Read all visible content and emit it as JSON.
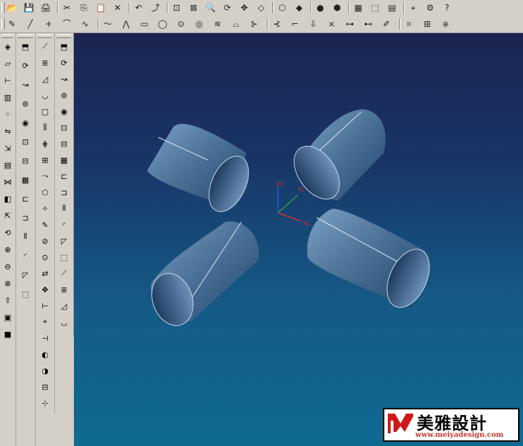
{
  "toolbar_top": {
    "buttons": [
      {
        "name": "open-icon",
        "glyph": "📂"
      },
      {
        "name": "save-icon",
        "glyph": "💾"
      },
      {
        "name": "print-icon",
        "glyph": "🖨"
      },
      {
        "name": "cut-icon",
        "glyph": "✂"
      },
      {
        "name": "copy-icon",
        "glyph": "⎘"
      },
      {
        "name": "paste-icon",
        "glyph": "📋"
      },
      {
        "name": "delete-icon",
        "glyph": "✕"
      },
      {
        "name": "undo-icon",
        "glyph": "↶"
      },
      {
        "name": "redo-icon",
        "glyph": "⤴"
      },
      {
        "name": "fit-view-icon",
        "glyph": "⊡"
      },
      {
        "name": "zoom-window-icon",
        "glyph": "⊠"
      },
      {
        "name": "zoom-icon",
        "glyph": "🔍"
      },
      {
        "name": "rotate-icon",
        "glyph": "⟳"
      },
      {
        "name": "pan-icon",
        "glyph": "✥"
      },
      {
        "name": "orient-view-icon",
        "glyph": "◇"
      },
      {
        "name": "wireframe-icon",
        "glyph": "⬡"
      },
      {
        "name": "shaded-icon",
        "glyph": "◆"
      },
      {
        "name": "material-icon",
        "glyph": "●"
      },
      {
        "name": "layer-icon",
        "glyph": "⬢"
      },
      {
        "name": "model-tree-icon",
        "glyph": "▦"
      },
      {
        "name": "assembly-icon",
        "glyph": "⬚"
      },
      {
        "name": "drafting-icon",
        "glyph": "▤"
      },
      {
        "name": "analysis-icon",
        "glyph": "⌖"
      },
      {
        "name": "cam-icon",
        "glyph": "⚙"
      },
      {
        "name": "help-icon",
        "glyph": "?"
      }
    ]
  },
  "toolbar_second": {
    "buttons": [
      {
        "name": "sketch-icon",
        "glyph": "✎"
      },
      {
        "name": "line-icon",
        "glyph": "╱"
      },
      {
        "name": "point-icon",
        "glyph": "+"
      },
      {
        "name": "arc-icon",
        "glyph": "⌒"
      },
      {
        "name": "curve-icon",
        "glyph": "∿"
      },
      {
        "name": "spline-icon",
        "glyph": "〜"
      },
      {
        "name": "polyline-icon",
        "glyph": "⋀"
      },
      {
        "name": "rectangle-icon",
        "glyph": "▭"
      },
      {
        "name": "circle-icon",
        "glyph": "◯"
      },
      {
        "name": "ellipse-icon",
        "glyph": "⊙"
      },
      {
        "name": "helix-icon",
        "glyph": "◎"
      },
      {
        "name": "offset-curve-icon",
        "glyph": "≋"
      },
      {
        "name": "bridge-curve-icon",
        "glyph": "⌓"
      },
      {
        "name": "trim-icon",
        "glyph": "⊱"
      },
      {
        "name": "extend-icon",
        "glyph": "⊰"
      },
      {
        "name": "fillet-curve-icon",
        "glyph": "⌐"
      },
      {
        "name": "project-curve-icon",
        "glyph": "⇩"
      },
      {
        "name": "intersect-curve-icon",
        "glyph": "⨯"
      },
      {
        "name": "join-curve-icon",
        "glyph": "⊶"
      },
      {
        "name": "split-curve-icon",
        "glyph": "⊷"
      },
      {
        "name": "edit-curve-icon",
        "glyph": "✐"
      },
      {
        "name": "surface-icon",
        "glyph": "⌗"
      },
      {
        "name": "mesh-icon",
        "glyph": "⊞"
      },
      {
        "name": "blend-icon",
        "glyph": "⎈"
      }
    ]
  },
  "left_toolbar_a": {
    "buttons": [
      {
        "name": "feature-icon",
        "glyph": "◈"
      },
      {
        "name": "datum-plane-icon",
        "glyph": "▱"
      },
      {
        "name": "datum-axis-icon",
        "glyph": "⊢"
      },
      {
        "name": "sheet-icon",
        "glyph": "▥"
      },
      {
        "name": "pattern-icon",
        "glyph": "⁘"
      },
      {
        "name": "mirror-icon",
        "glyph": "⇋"
      },
      {
        "name": "offset-icon",
        "glyph": "⇲"
      },
      {
        "name": "thicken-icon",
        "glyph": "▤"
      },
      {
        "name": "sew-icon",
        "glyph": "⋈"
      },
      {
        "name": "trim-body-icon",
        "glyph": "◧"
      },
      {
        "name": "scale-icon",
        "glyph": "⇱"
      },
      {
        "name": "wrap-icon",
        "glyph": "⟲"
      },
      {
        "name": "unite-icon",
        "glyph": "⊕"
      },
      {
        "name": "subtract-icon",
        "glyph": "⊖"
      },
      {
        "name": "intersect-icon",
        "glyph": "⊗"
      },
      {
        "name": "extract-icon",
        "glyph": "⇪"
      },
      {
        "name": "instance-icon",
        "glyph": "▣"
      },
      {
        "name": "block-icon",
        "glyph": "■"
      },
      {
        "name": "cylinder-icon",
        "glyph": "⬭"
      },
      {
        "name": "cone-icon",
        "glyph": "△"
      },
      {
        "name": "sphere-icon",
        "glyph": "●"
      }
    ]
  },
  "left_toolbar_b": {
    "buttons": [
      {
        "name": "extrude-icon",
        "glyph": "⬒"
      },
      {
        "name": "revolve-icon",
        "glyph": "⟳"
      },
      {
        "name": "sweep-icon",
        "glyph": "↝"
      },
      {
        "name": "tube-icon",
        "glyph": "⊚"
      },
      {
        "name": "hole-icon",
        "glyph": "◉"
      },
      {
        "name": "boss-icon",
        "glyph": "⊡"
      },
      {
        "name": "pocket-icon",
        "glyph": "⊟"
      },
      {
        "name": "pad-icon",
        "glyph": "▦"
      },
      {
        "name": "slot-icon",
        "glyph": "⊏"
      },
      {
        "name": "groove-icon",
        "glyph": "⊐"
      },
      {
        "name": "rib-icon",
        "glyph": "⫴"
      },
      {
        "name": "edge-blend-icon",
        "glyph": "◜"
      },
      {
        "name": "chamfer-icon",
        "glyph": "◸"
      },
      {
        "name": "shell-icon",
        "glyph": "⬚"
      },
      {
        "name": "draft-icon",
        "glyph": "⟋"
      },
      {
        "name": "thread-icon",
        "glyph": "≣"
      },
      {
        "name": "taper-icon",
        "glyph": "◿"
      },
      {
        "name": "face-blend-icon",
        "glyph": "◡"
      },
      {
        "name": "bound-plane-icon",
        "glyph": "▢"
      },
      {
        "name": "ruled-icon",
        "glyph": "⫼"
      },
      {
        "name": "through-curves-icon",
        "glyph": "⋕"
      },
      {
        "name": "mesh-surface-icon",
        "glyph": "⊞"
      },
      {
        "name": "swept-surface-icon",
        "glyph": "⤳"
      },
      {
        "name": "n-sided-icon",
        "glyph": "⬠"
      },
      {
        "name": "studio-icon",
        "glyph": "✧"
      },
      {
        "name": "edit-feature-icon",
        "glyph": "✎"
      },
      {
        "name": "suppress-icon",
        "glyph": "⊘"
      },
      {
        "name": "unsuppress-icon",
        "glyph": "⊙"
      },
      {
        "name": "replace-icon",
        "glyph": "⇄"
      },
      {
        "name": "move-object-icon",
        "glyph": "✥"
      },
      {
        "name": "measure-icon",
        "glyph": "⊢"
      },
      {
        "name": "analyze-icon",
        "glyph": "⌖"
      },
      {
        "name": "section-icon",
        "glyph": "⊣"
      },
      {
        "name": "color-icon",
        "glyph": "◐"
      },
      {
        "name": "show-hide-icon",
        "glyph": "◑"
      },
      {
        "name": "layer-setting-icon",
        "glyph": "⊟"
      },
      {
        "name": "wcs-icon",
        "glyph": "⊹"
      },
      {
        "name": "snap-icon",
        "glyph": "⌑"
      }
    ]
  },
  "viewport": {
    "wcs": {
      "z_label": "ZC",
      "y_label": "YC",
      "x_label": "XC"
    },
    "status_text": "",
    "colors": {
      "bg_top": "#1b2450",
      "bg_bottom": "#0f6a92",
      "body": "#4d7399",
      "body_dark": "#21416a",
      "rim": "#c8d8ea",
      "axis_z": "#2a55ff",
      "axis_y": "#2aa82a",
      "axis_x": "#d03030"
    }
  },
  "watermark": {
    "brand_cn": "美雅設計",
    "url": "www.meiyadesign.com"
  }
}
